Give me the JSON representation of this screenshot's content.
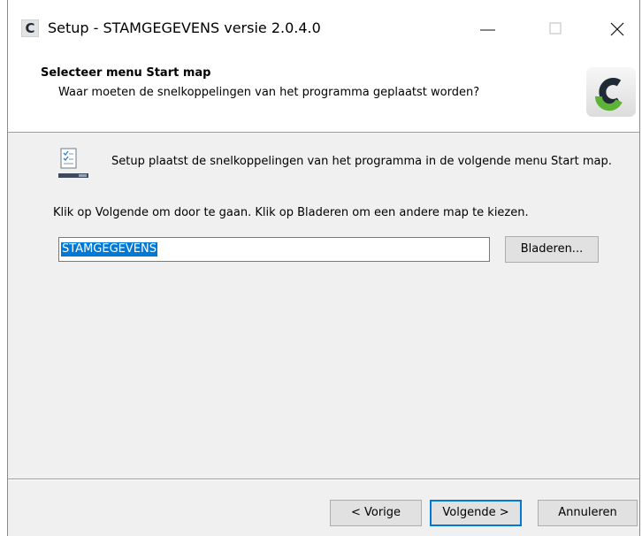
{
  "window": {
    "title": "Setup - STAMGEGEVENS versie 2.0.4.0",
    "app_icon_letter": "C",
    "minimize_icon": "minimize-icon",
    "maximize_icon": "maximize-icon",
    "close_icon": "close-icon"
  },
  "header": {
    "title": "Selecteer menu Start map",
    "subtitle": "Waar moeten de snelkoppelingen van het programma geplaatst worden?",
    "logo_icon": "brand-logo-c"
  },
  "content": {
    "icon": "start-menu-folder-icon",
    "description": "Setup plaatst de snelkoppelingen van het programma in de volgende menu Start map.",
    "instruction": "Klik op Volgende om door te gaan. Klik op Bladeren om een andere map te kiezen.",
    "folder_value": "STAMGEGEVENS",
    "browse_label": "Bladeren..."
  },
  "footer": {
    "back_label": "< Vorige",
    "next_label": "Volgende >",
    "cancel_label": "Annuleren"
  },
  "colors": {
    "accent": "#0078d7",
    "logo_green": "#5cb335",
    "logo_dark": "#1f2a36"
  }
}
